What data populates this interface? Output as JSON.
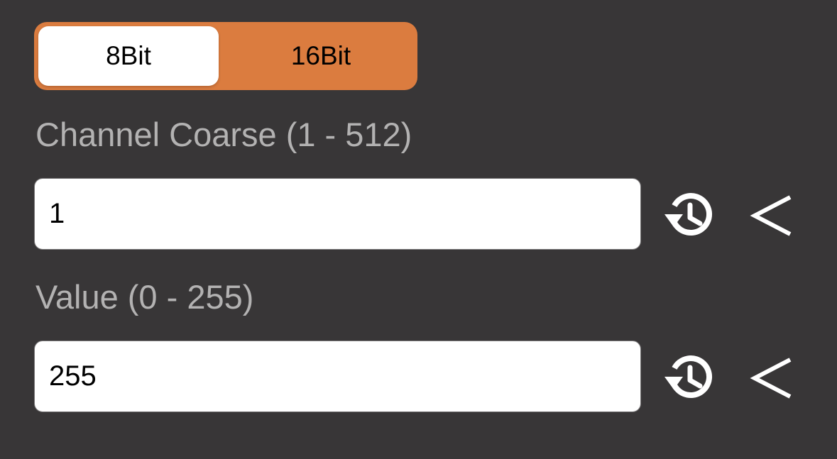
{
  "bit_mode": {
    "options": [
      "8Bit",
      "16Bit"
    ],
    "selected": "8Bit"
  },
  "fields": [
    {
      "label": "Channel Coarse (1 - 512)",
      "value": "1"
    },
    {
      "label": "Value (0 - 255)",
      "value": "255"
    }
  ],
  "icons": {
    "history": "history-icon",
    "back": "chevron-left-icon"
  },
  "colors": {
    "background": "#383637",
    "accent": "#DB7C3F",
    "label": "#B3B2B2",
    "input_bg": "#FFFFFF"
  }
}
